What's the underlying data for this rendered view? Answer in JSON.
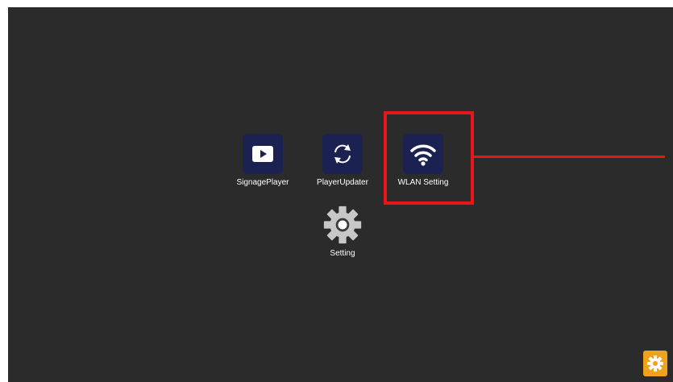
{
  "apps": {
    "signage_player": {
      "label": "SignagePlayer",
      "icon": "play-icon"
    },
    "player_updater": {
      "label": "PlayerUpdater",
      "icon": "refresh-icon"
    },
    "wlan_setting": {
      "label": "WLAN Setting",
      "icon": "wifi-icon"
    },
    "setting": {
      "label": "Setting",
      "icon": "gear-icon"
    }
  },
  "colors": {
    "background": "#2b2b2b",
    "tile": "#1b2150",
    "highlight": "#e8151a",
    "corner_button": "#f1a21c"
  },
  "corner_button": {
    "icon": "gear-icon"
  }
}
